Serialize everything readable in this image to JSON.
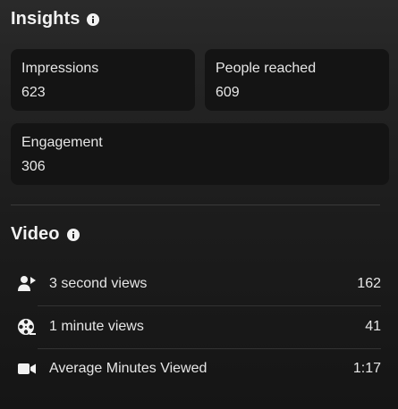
{
  "insights": {
    "title": "Insights",
    "cards": [
      {
        "label": "Impressions",
        "value": "623"
      },
      {
        "label": "People reached",
        "value": "609"
      },
      {
        "label": "Engagement",
        "value": "306"
      }
    ]
  },
  "video": {
    "title": "Video",
    "rows": [
      {
        "icon": "person-play-icon",
        "label": "3 second views",
        "value": "162"
      },
      {
        "icon": "film-reel-icon",
        "label": "1 minute views",
        "value": "41"
      },
      {
        "icon": "video-camera-icon",
        "label": "Average Minutes Viewed",
        "value": "1:17"
      }
    ]
  },
  "colors": {
    "background_top": "#2a2a2a",
    "background_bottom": "#151515",
    "card": "#141414",
    "text": "#e6e6e6",
    "divider": "#3a3a3a"
  }
}
